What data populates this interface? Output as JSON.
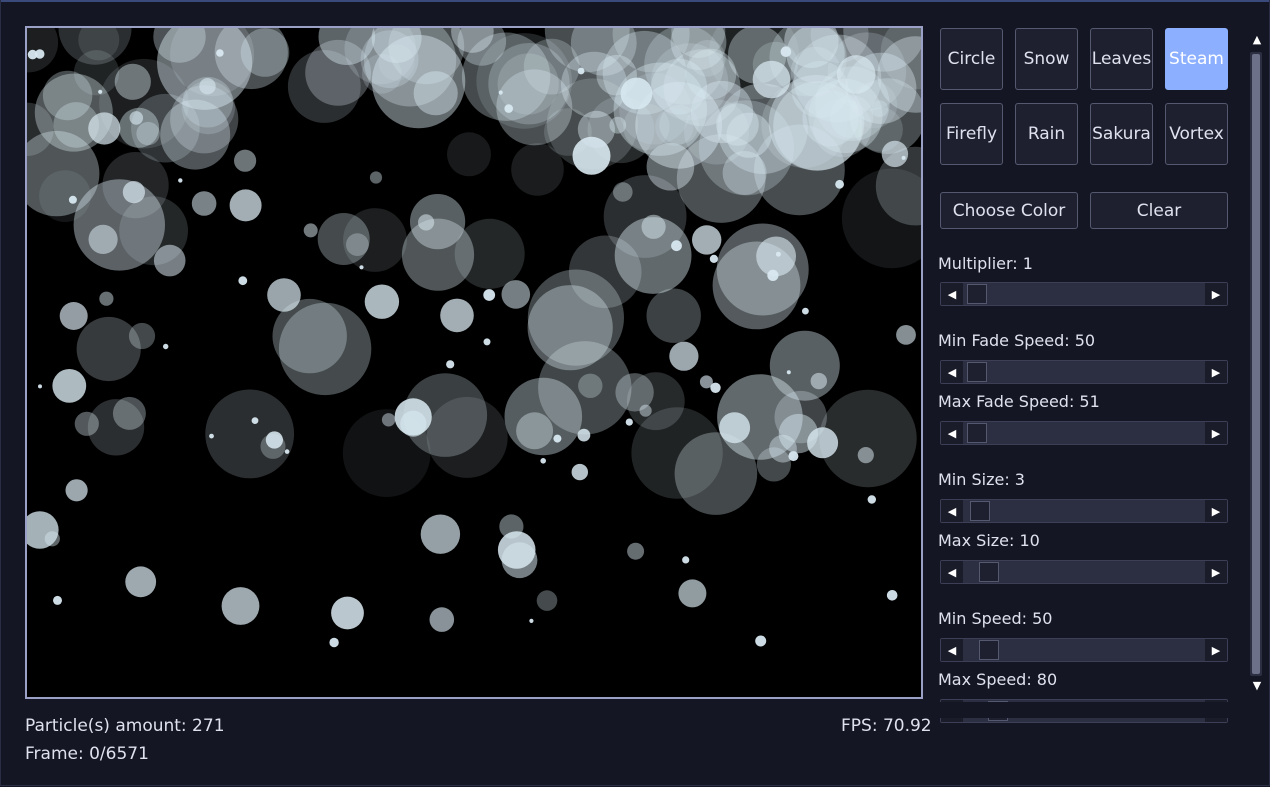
{
  "modes": [
    "Circle",
    "Snow",
    "Leaves",
    "Steam",
    "Firefly",
    "Rain",
    "Sakura",
    "Vortex"
  ],
  "active_mode": "Steam",
  "buttons": {
    "choose_color": "Choose Color",
    "clear": "Clear"
  },
  "sliders": [
    {
      "label": "Multiplier: 1",
      "value": 0.02
    },
    {
      "label": "Min Fade Speed: 50",
      "value": 0.02
    },
    {
      "label": "Max Fade Speed: 51",
      "value": 0.02
    },
    {
      "label": "Min Size: 3",
      "value": 0.03
    },
    {
      "label": "Max Size: 10",
      "value": 0.07
    },
    {
      "label": "Min Speed: 50",
      "value": 0.07
    },
    {
      "label": "Max Speed: 80",
      "value": 0.11
    }
  ],
  "status": {
    "particle_amount": "Particle(s) amount: 271",
    "frame": "Frame: 0/6571",
    "fps": "FPS: 70.92"
  },
  "colors": {
    "accent": "#8cb0ff",
    "background": "#141624",
    "canvas": "#000000",
    "particle": "#d8e8f0"
  }
}
